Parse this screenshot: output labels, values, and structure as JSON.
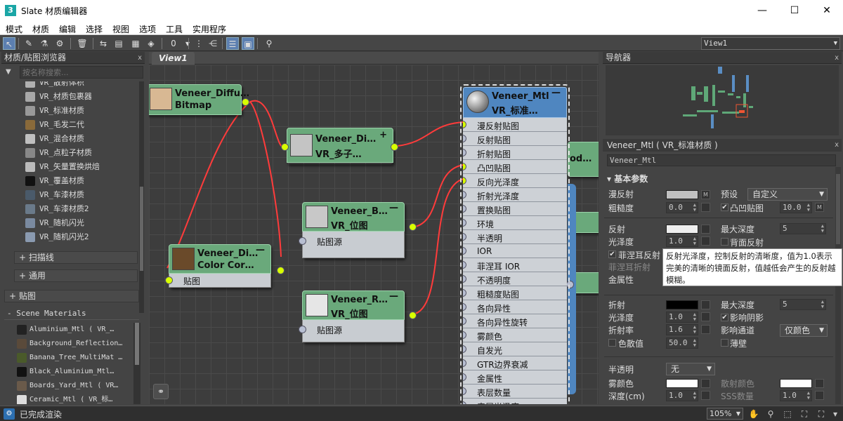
{
  "window": {
    "title": "Slate 材质编辑器",
    "app_icon": "3",
    "minimize": "—",
    "maximize": "☐",
    "close": "✕"
  },
  "menu": [
    "模式",
    "材质",
    "编辑",
    "选择",
    "视图",
    "选项",
    "工具",
    "实用程序"
  ],
  "toolbar": {
    "view_select": "View1"
  },
  "browser": {
    "title": "材质/贴图浏览器",
    "close": "x",
    "search_placeholder": "按名称搜索...",
    "materials": [
      {
        "label": "VR_散射体积",
        "color": "#b0b0b0"
      },
      {
        "label": "VR_材质包裹器",
        "color": "#a8a8a8"
      },
      {
        "label": "VR_标准材质",
        "color": "#999999"
      },
      {
        "label": "VR_毛发二代",
        "color": "#8a6a3a"
      },
      {
        "label": "VR_混合材质",
        "color": "#c0c0c0"
      },
      {
        "label": "VR_点粒子材质",
        "color": "#888888"
      },
      {
        "label": "VR_矢量置换烘焙",
        "color": "#bbbbbb"
      },
      {
        "label": "VR_覆盖材质",
        "color": "#111111"
      },
      {
        "label": "VR_车漆材质",
        "color": "#4a5a6a"
      },
      {
        "label": "VR_车漆材质2",
        "color": "#6a7a8a"
      },
      {
        "label": "VR_随机闪光",
        "color": "#7a8aa0"
      },
      {
        "label": "VR_随机闪光2",
        "color": "#8a9ab0"
      }
    ],
    "rollouts": {
      "scanline": "+ 扫描线",
      "general": "+ 通用",
      "maps": "+ 贴图"
    },
    "scene_title": "- Scene Materials",
    "scene_items": [
      {
        "label": "Aluminium_Mtl  ( VR_…",
        "color": "#222222"
      },
      {
        "label": "Background_Reflection…",
        "color": "#5a4a3a"
      },
      {
        "label": "Banana_Tree_MultiMat …",
        "color": "#4a5a2a"
      },
      {
        "label": "Black_Aluminium_Mtl…",
        "color": "#111111"
      },
      {
        "label": "Boards_Yard_Mtl  ( VR…",
        "color": "#6a5a4a"
      },
      {
        "label": "Ceramic_Mtl  ( VR_标…",
        "color": "#dddddd"
      }
    ]
  },
  "view": {
    "tab": "View1"
  },
  "nodes": {
    "diffuse_bitmap": {
      "title": "Veneer_Diffu…",
      "subtitle": "Bitmap"
    },
    "multi": {
      "title": "Veneer_Di…",
      "subtitle": "VR_多子…",
      "plus": "+"
    },
    "bump": {
      "title": "Veneer_B…",
      "subtitle": "VR_位图",
      "slot": "贴图源",
      "min": "—"
    },
    "colorcorrect": {
      "title": "Veneer_Di…",
      "subtitle": "Color Cor…",
      "slot": "贴图",
      "min": "—"
    },
    "rough": {
      "title": "Veneer_R…",
      "subtitle": "VR_位图",
      "slot": "贴图源",
      "min": "—"
    },
    "mtl": {
      "title": "Veneer_Mtl",
      "subtitle": "VR_标准…",
      "min": "—",
      "slots": [
        "漫反射贴图",
        "反射贴图",
        "折射贴图",
        "凸凹贴图",
        "反向光泽度",
        "折射光泽度",
        "置换贴图",
        "环境",
        "半透明",
        "IOR",
        "菲涅耳 IOR",
        "不透明度",
        "粗糙度贴图",
        "各向异性",
        "各向异性旋转",
        "雾颜色",
        "自发光",
        "GTR边界衰减",
        "金属性",
        "表层数量",
        "表层光泽度"
      ]
    },
    "hidden_right_label": "od…"
  },
  "navigator": {
    "title": "导航器",
    "close": "x"
  },
  "params": {
    "title": "Veneer_Mtl  ( VR_标准材质 )",
    "name_value": "Veneer_Mtl",
    "rollout": "▾ 基本参数",
    "diffuse": "漫反射",
    "roughness": "粗糙度",
    "roughness_val": "0.0",
    "preset": "预设",
    "preset_val": "自定义",
    "bump": "凸凹贴图",
    "bump_val": "10.0",
    "reflect": "反射",
    "gloss": "光泽度",
    "gloss_val": "1.0",
    "max_depth": "最大深度",
    "max_depth_val": "5",
    "back_reflect": "背面反射",
    "fresnel": "菲涅耳反射",
    "fresnel_ior": "菲涅耳折射",
    "metalness": "金属性",
    "refract": "折射",
    "refr_gloss": "光泽度",
    "refr_gloss_val": "1.0",
    "refr_max_depth": "最大深度",
    "refr_max_depth_val": "5",
    "ior": "折射率",
    "ior_val": "1.6",
    "affect_shadows": "影响阴影",
    "affect_channel": "影响通道",
    "channel_val": "仅颜色",
    "dispersion": "色散值",
    "dispersion_val": "50.0",
    "thin_walled": "薄壁",
    "translucency": "半透明",
    "translucency_val": "无",
    "fog_color": "雾颜色",
    "scatter_color": "散射颜色",
    "depth": "深度(cm)",
    "depth_val": "1.0",
    "sss_amount": "SSS数量",
    "sss_val": "1.0",
    "m": "M",
    "tooltip": "反射光泽度，控制反射的清晰度，值为1.0表示完美的清晰的镜面反射，值越低会产生的反射越模糊。"
  },
  "status": {
    "text": "已完成渲染",
    "zoom": "105%"
  },
  "colors": {
    "node_green": "#6aa97b",
    "node_blue": "#4f86c0",
    "wire": "#ff3b3b",
    "socket": "#d8ff00"
  }
}
